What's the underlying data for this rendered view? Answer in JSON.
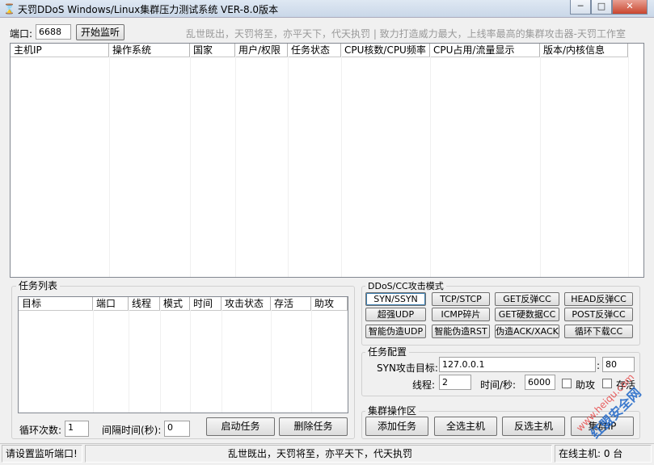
{
  "window": {
    "title": "天罚DDoS Windows/Linux集群压力测试系统 VER-8.0版本",
    "minimize": "─",
    "maximize": "□",
    "close": "✕"
  },
  "toolbar": {
    "port_label": "端口:",
    "port_value": "6688",
    "listen_button": "开始监听",
    "slogan": "乱世既出，天罚将至，亦平天下，代天执罚 | 致力打造威力最大，上线率最高的集群攻击器-天罚工作室"
  },
  "hosts_table": {
    "columns": [
      "主机IP",
      "操作系统",
      "国家",
      "用户/权限",
      "任务状态",
      "CPU核数/CPU频率",
      "CPU占用/流量显示",
      "版本/内核信息"
    ]
  },
  "task_list": {
    "title": "任务列表",
    "columns": [
      "目标",
      "端口",
      "线程",
      "模式",
      "时间",
      "攻击状态",
      "存活",
      "助攻"
    ],
    "loop_label": "循环次数:",
    "loop_value": "1",
    "interval_label": "间隔时间(秒):",
    "interval_value": "0",
    "start_button": "启动任务",
    "delete_button": "删除任务"
  },
  "attack_modes": {
    "title": "DDoS/CC攻击模式",
    "buttons": [
      "SYN/SSYN",
      "TCP/STCP",
      "GET反弹CC",
      "HEAD反弹CC",
      "超强UDP",
      "ICMP碎片",
      "GET硬数据CC",
      "POST反弹CC",
      "智能伪造UDP",
      "智能伪造RST",
      "伪造ACK/XACK",
      "循环下载CC"
    ],
    "selected": "SYN/SSYN"
  },
  "task_config": {
    "title": "任务配置",
    "target_label": "SYN攻击目标:",
    "target_value": "127.0.0.1",
    "colon": ":",
    "port_value": "80",
    "threads_label": "线程:",
    "threads_value": "2",
    "time_label": "时间/秒:",
    "time_value": "6000",
    "assist_label": "助攻",
    "survive_label": "存活"
  },
  "cluster_ops": {
    "title": "集群操作区",
    "add_task": "添加任务",
    "select_all": "全选主机",
    "invert_select": "反选主机",
    "cluster_ip": "集群IP"
  },
  "statusbar": {
    "message": "请设置监听端口!",
    "slogan": "乱世既出，天罚将至，亦平天下，代天执罚",
    "online": "在线主机: 0 台"
  },
  "watermark": {
    "line1": "www.heiqu.com",
    "line2": "红盟安全网"
  }
}
